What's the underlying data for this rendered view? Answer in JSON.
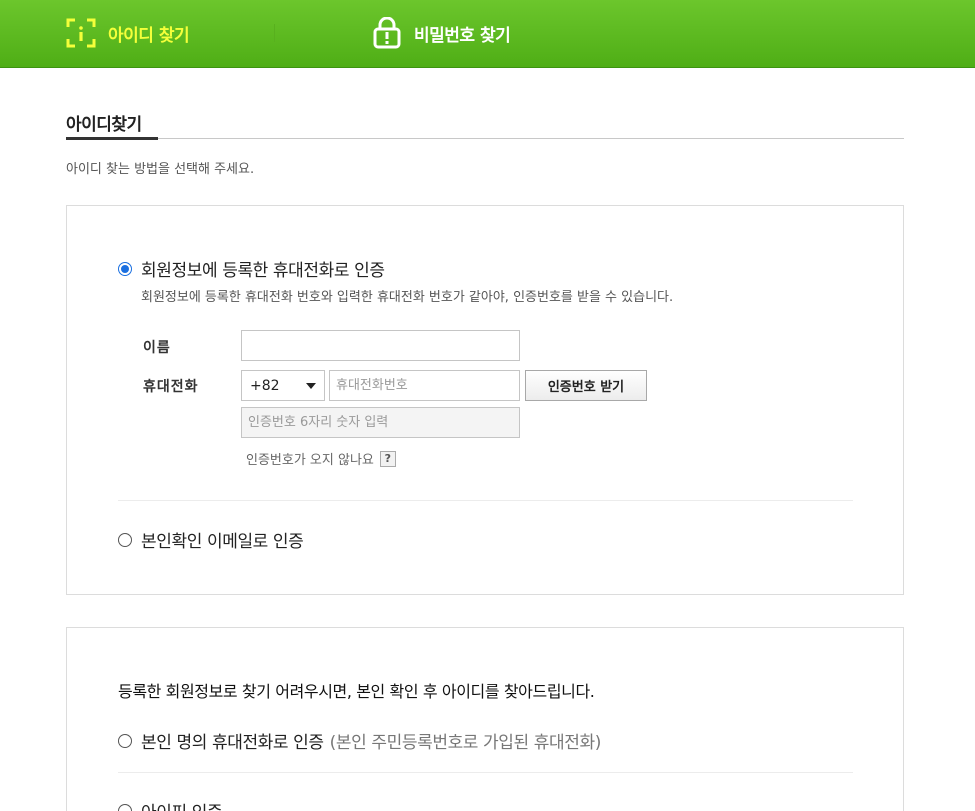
{
  "tabs": {
    "find_id": "아이디 찾기",
    "find_password": "비밀번호 찾기"
  },
  "section": {
    "title": "아이디찾기",
    "description": "아이디 찾는 방법을 선택해 주세요."
  },
  "method_phone": {
    "label": "회원정보에 등록한 휴대전화로 인증",
    "help": "회원정보에 등록한 휴대전화 번호와 입력한 휴대전화 번호가 같아야, 인증번호를 받을 수 있습니다.",
    "name_label": "이름",
    "name_value": "",
    "phone_label": "휴대전화",
    "country_code": "+82",
    "phone_placeholder": "휴대전화번호",
    "get_code_button": "인증번호 받기",
    "code_placeholder": "인증번호 6자리 숫자 입력",
    "no_code_text": "인증번호가 오지 않나요",
    "help_icon": "?"
  },
  "method_email": {
    "label": "본인확인 이메일로 인증"
  },
  "alternative": {
    "heading": "등록한 회원정보로 찾기 어려우시면, 본인 확인 후 아이디를 찾아드립니다.",
    "own_phone_label": "본인 명의 휴대전화로 인증",
    "own_phone_sub": "(본인 주민등록번호로 가입된 휴대전화)",
    "ipin_label": "아이핀 인증"
  },
  "colors": {
    "brand_green": "#5bb820",
    "active_tab_text": "#f4ff3a",
    "radio_checked": "#1a6fe0"
  }
}
